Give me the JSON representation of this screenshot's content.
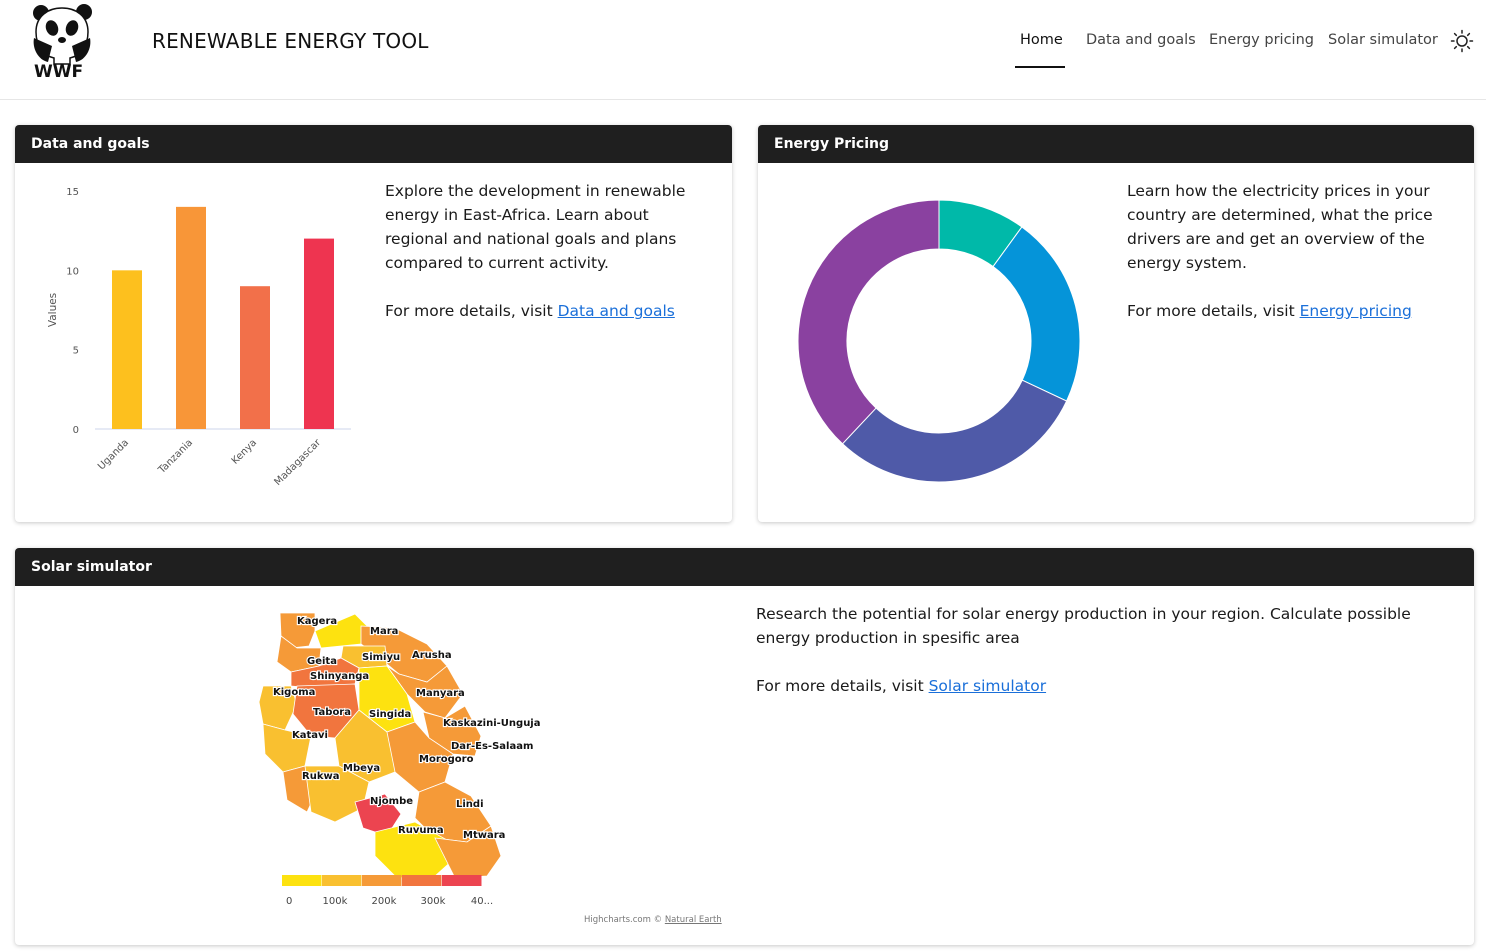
{
  "header": {
    "logo_text": "WWF",
    "title": "RENEWABLE ENERGY TOOL",
    "nav": [
      {
        "label": "Home",
        "active": true
      },
      {
        "label": "Data and goals",
        "active": false
      },
      {
        "label": "Energy pricing",
        "active": false
      },
      {
        "label": "Solar simulator",
        "active": false
      }
    ],
    "theme_icon": "sun-icon"
  },
  "cards": {
    "data_goals": {
      "title": "Data and goals",
      "description": "Explore the development in renewable energy in East-Africa. Learn about regional and national goals and plans compared to current activity.",
      "details_prefix": "For more details, visit ",
      "link": "Data and goals"
    },
    "energy_pricing": {
      "title": "Energy Pricing",
      "description": "Learn how the electricity prices in your country are determined, what the price drivers are and get an overview of the energy system.",
      "details_prefix": "For more details, visit ",
      "link": "Energy pricing"
    },
    "solar": {
      "title": "Solar simulator",
      "description": "Research the potential for solar energy production in your region. Calculate possible energy production in spesific area",
      "details_prefix": "For more details, visit ",
      "link": "Solar simulator",
      "credit_prefix": "Highcharts.com © ",
      "credit_link": "Natural Earth"
    }
  },
  "chart_data": [
    {
      "type": "bar",
      "categories": [
        "Uganda",
        "Tanzania",
        "Kenya",
        "Madagascar"
      ],
      "values": [
        10,
        14,
        9,
        12
      ],
      "colors": [
        "#fdc01e",
        "#f89638",
        "#f2704a",
        "#ee3450"
      ],
      "ylabel": "Values",
      "ylim": [
        0,
        15
      ],
      "yticks": [
        0,
        5,
        10,
        15
      ],
      "grid": false
    },
    {
      "type": "pie",
      "donut": true,
      "values": [
        10,
        22,
        30,
        38
      ],
      "colors": [
        "#00b9a9",
        "#0594d9",
        "#4f5aa8",
        "#8a41a0"
      ],
      "labels_shown": false
    },
    {
      "type": "choropleth",
      "regions": [
        "Kagera",
        "Mara",
        "Geita",
        "Simiyu",
        "Arusha",
        "Shinyanga",
        "Kigoma",
        "Manyara",
        "Tabora",
        "Singida",
        "Kaskazini-Unguja",
        "Katavi",
        "Dar-Es-Salaam",
        "Morogoro",
        "Rukwa",
        "Mbeya",
        "Njombe",
        "Lindi",
        "Ruvuma",
        "Mtwara"
      ],
      "legend_ticks": [
        "0",
        "100k",
        "200k",
        "300k",
        "40..."
      ],
      "legend_colors": [
        "#fde210",
        "#f9c030",
        "#f59a38",
        "#f1753e",
        "#ec4450"
      ]
    }
  ]
}
